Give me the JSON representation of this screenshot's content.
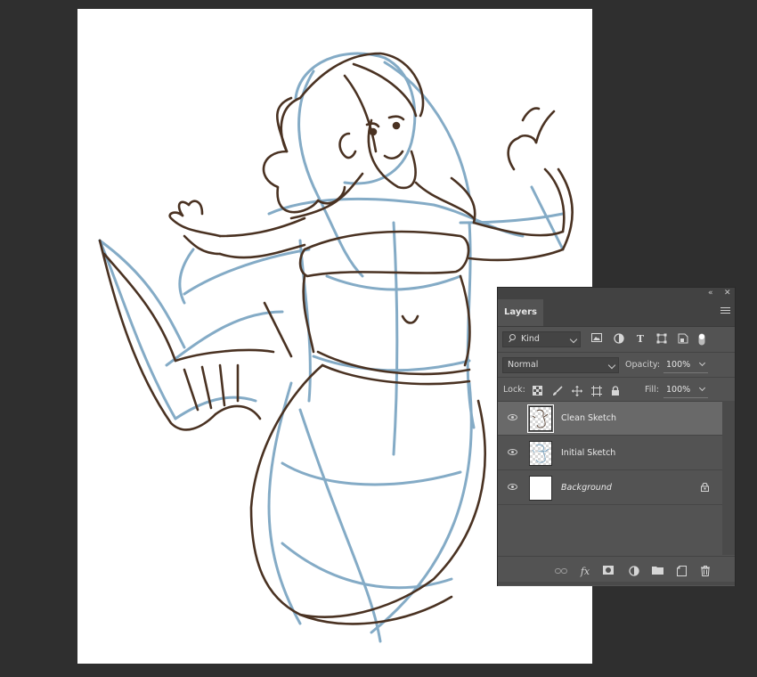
{
  "panel": {
    "tab_label": "Layers",
    "collapse_icon": "collapse-double-chevron-icon",
    "close_icon": "close-icon",
    "menu_icon": "panel-menu-icon"
  },
  "filter": {
    "kind_label": "Kind",
    "icons": [
      "image-filter-icon",
      "adjustment-filter-icon",
      "type-filter-icon",
      "shape-filter-icon",
      "smart-object-filter-icon",
      "filter-toggle-icon"
    ]
  },
  "blend": {
    "mode": "Normal",
    "opacity_label": "Opacity:",
    "opacity_value": "100%"
  },
  "lock": {
    "label": "Lock:",
    "fill_label": "Fill:",
    "fill_value": "100%",
    "icons": [
      "lock-transparent-pixels-icon",
      "lock-image-pixels-icon",
      "lock-position-icon",
      "lock-artboard-icon",
      "lock-all-icon"
    ]
  },
  "layers": [
    {
      "name": "Clean Sketch",
      "selected": true,
      "visible": true
    },
    {
      "name": "Initial Sketch",
      "selected": false,
      "visible": true
    },
    {
      "name": "Background",
      "selected": false,
      "visible": true,
      "locked": true
    }
  ],
  "bottom_icons": [
    "link-layers-icon",
    "fx-icon",
    "add-mask-icon",
    "new-adjustment-layer-icon",
    "new-group-icon",
    "new-layer-icon",
    "trash-icon"
  ],
  "colors": {
    "workspace": "#2f2f2f",
    "panel": "#535353",
    "selected_row": "#696969",
    "sketch_blue": "#6f9dbd",
    "sketch_brown": "#4a3222"
  }
}
